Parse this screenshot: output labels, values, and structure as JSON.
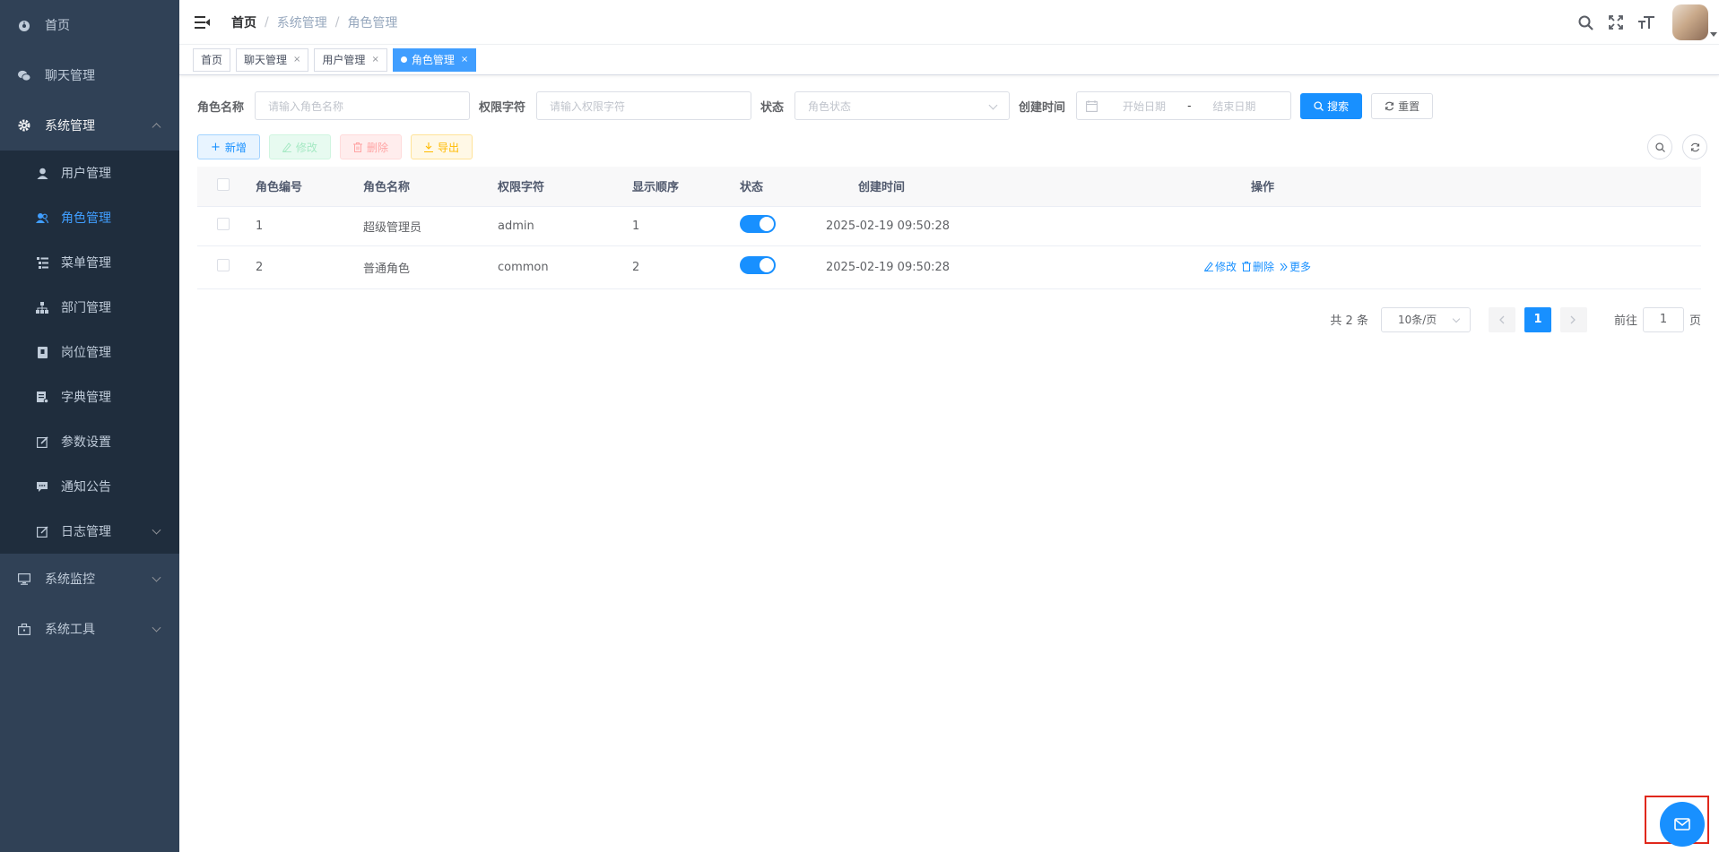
{
  "sidebar": {
    "items": [
      {
        "label": "首页",
        "icon": "dashboard-icon"
      },
      {
        "label": "聊天管理",
        "icon": "wechat-icon"
      },
      {
        "label": "系统管理",
        "icon": "gear-icon"
      }
    ],
    "system_sub": [
      {
        "label": "用户管理",
        "icon": "user-icon"
      },
      {
        "label": "角色管理",
        "icon": "peoples-icon"
      },
      {
        "label": "菜单管理",
        "icon": "tree-table-icon"
      },
      {
        "label": "部门管理",
        "icon": "tree-icon"
      },
      {
        "label": "岗位管理",
        "icon": "post-icon"
      },
      {
        "label": "字典管理",
        "icon": "dict-icon"
      },
      {
        "label": "参数设置",
        "icon": "edit-icon"
      },
      {
        "label": "通知公告",
        "icon": "message-icon"
      },
      {
        "label": "日志管理",
        "icon": "log-icon"
      }
    ],
    "bottom": [
      {
        "label": "系统监控",
        "icon": "monitor-icon"
      },
      {
        "label": "系统工具",
        "icon": "tool-icon"
      }
    ]
  },
  "breadcrumb": [
    "首页",
    "系统管理",
    "角色管理"
  ],
  "breadcrumb_sep": "/",
  "tags": [
    {
      "label": "首页",
      "closable": false
    },
    {
      "label": "聊天管理",
      "closable": true
    },
    {
      "label": "用户管理",
      "closable": true
    },
    {
      "label": "角色管理",
      "closable": true,
      "active": true
    }
  ],
  "tag_close": "×",
  "search": {
    "role_name_label": "角色名称",
    "role_name_placeholder": "请输入角色名称",
    "role_key_label": "权限字符",
    "role_key_placeholder": "请输入权限字符",
    "status_label": "状态",
    "status_placeholder": "角色状态",
    "time_label": "创建时间",
    "start_placeholder": "开始日期",
    "range_sep": "-",
    "end_placeholder": "结束日期",
    "search_btn": "搜索",
    "reset_btn": "重置"
  },
  "toolbar": {
    "add": "新增",
    "edit": "修改",
    "delete": "删除",
    "export": "导出"
  },
  "table": {
    "columns": [
      "角色编号",
      "角色名称",
      "权限字符",
      "显示顺序",
      "状态",
      "创建时间",
      "操作"
    ],
    "rows": [
      {
        "id": "1",
        "name": "超级管理员",
        "key": "admin",
        "sort": "1",
        "status_on": true,
        "time": "2025-02-19 09:50:28",
        "ops": []
      },
      {
        "id": "2",
        "name": "普通角色",
        "key": "common",
        "sort": "2",
        "status_on": true,
        "time": "2025-02-19 09:50:28",
        "ops": [
          "修改",
          "删除",
          "更多"
        ]
      }
    ]
  },
  "pagination": {
    "total": "共 2 条",
    "page_size": "10条/页",
    "current_page": "1",
    "goto_label": "前往",
    "goto_value": "1",
    "page_unit": "页"
  },
  "colors": {
    "primary": "#1890ff",
    "sidebar_bg": "#304156",
    "submenu_bg": "#1f2d3d"
  }
}
